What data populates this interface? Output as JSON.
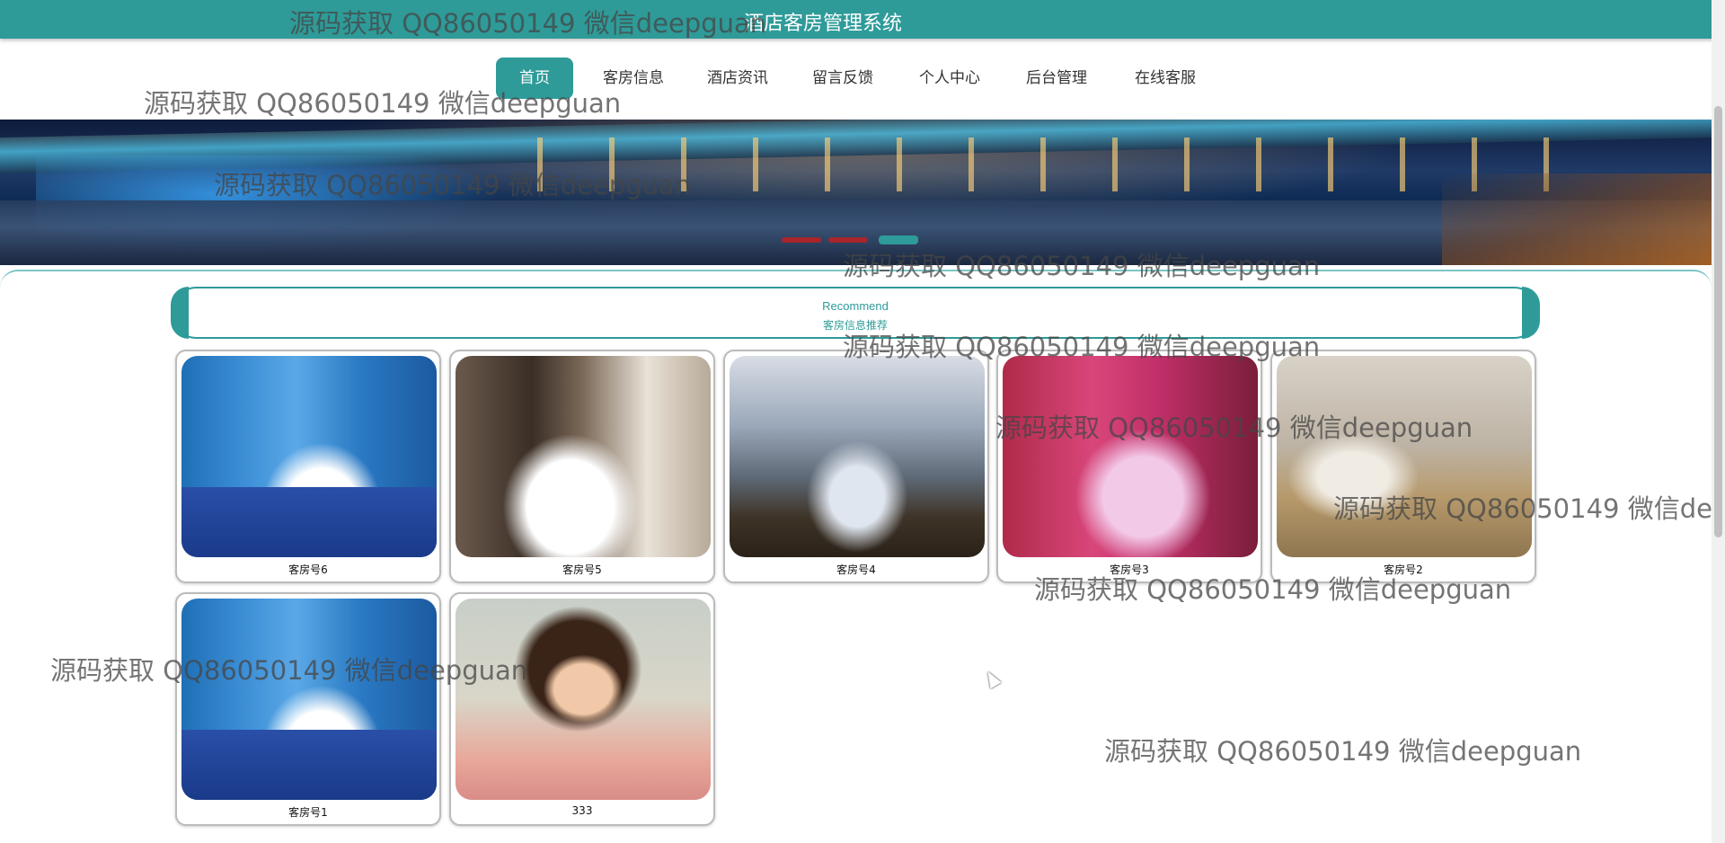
{
  "header": {
    "title": "酒店客房管理系统"
  },
  "nav": {
    "items": [
      {
        "label": "首页",
        "active": true
      },
      {
        "label": "客房信息"
      },
      {
        "label": "酒店资讯"
      },
      {
        "label": "留言反馈"
      },
      {
        "label": "个人中心"
      },
      {
        "label": "后台管理"
      },
      {
        "label": "在线客服"
      }
    ]
  },
  "banner": {
    "slide_count": 3,
    "active_slide": 3
  },
  "recommend": {
    "en": "Recommend",
    "zh": "客房信息推荐"
  },
  "rooms": [
    {
      "name": "客房号6",
      "photo": "blue-ocean-themed-room"
    },
    {
      "name": "客房号5",
      "photo": "white-bed-dark-wood-room"
    },
    {
      "name": "客房号4",
      "photo": "cabin-style-room"
    },
    {
      "name": "客房号3",
      "photo": "pink-romantic-room"
    },
    {
      "name": "客房号2",
      "photo": "suite-room"
    },
    {
      "name": "客房号1",
      "photo": "blue-ocean-themed-room"
    },
    {
      "name": "333",
      "photo": "portrait-woman"
    }
  ],
  "watermark": {
    "text": "源码获取 QQ86050149 微信deepguan"
  },
  "colors": {
    "accent": "#2e9b99",
    "background": "#ffffff"
  }
}
